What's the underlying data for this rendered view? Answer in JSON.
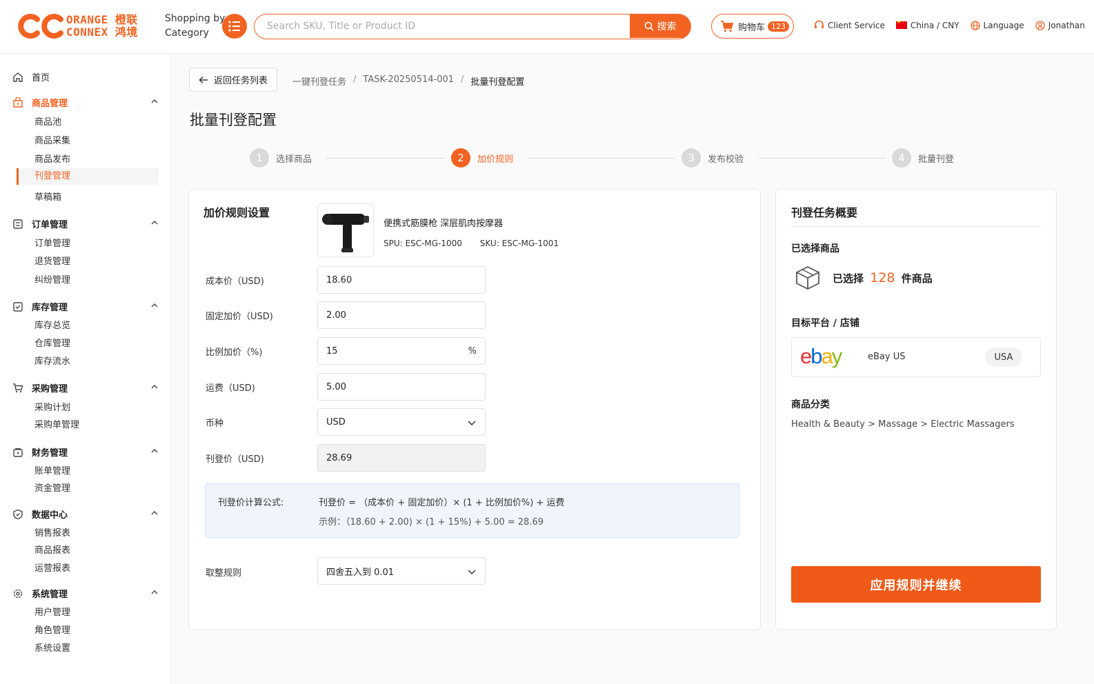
{
  "brand": {
    "line1": "ORANGE 橙联",
    "line2": "CONNEX 鸿境",
    "accent": "#f26322"
  },
  "header": {
    "shopping_by": "Shopping by",
    "category": "Category",
    "search_placeholder": "Search SKU, Title or Product ID",
    "search_button": "搜索",
    "cart_label": "购物车",
    "cart_count": "123",
    "client_service": "Client Service",
    "region": "China / CNY",
    "language": "Language",
    "user": "Jonathan"
  },
  "sidebar": {
    "home": "首页",
    "groups": [
      {
        "label": "商品管理",
        "icon": "shop-icon",
        "items": [
          "商品池",
          "商品采集",
          "商品发布",
          "刊登管理",
          "草稿箱"
        ]
      },
      {
        "label": "订单管理",
        "icon": "order-icon",
        "items": [
          "订单管理",
          "退货管理",
          "纠纷管理"
        ]
      },
      {
        "label": "库存管理",
        "icon": "inventory-icon",
        "items": [
          "库存总览",
          "仓库管理",
          "库存流水"
        ]
      },
      {
        "label": "采购管理",
        "icon": "cart-icon",
        "items": [
          "采购计划",
          "采购单管理"
        ]
      },
      {
        "label": "财务管理",
        "icon": "wallet-icon",
        "items": [
          "账单管理",
          "资金管理"
        ]
      },
      {
        "label": "数据中心",
        "icon": "shield-icon",
        "items": [
          "销售报表",
          "商品报表",
          "运营报表"
        ]
      },
      {
        "label": "系统管理",
        "icon": "gear-icon",
        "items": [
          "用户管理",
          "角色管理",
          "系统设置"
        ]
      }
    ]
  },
  "page": {
    "back_button": "返回任务列表",
    "breadcrumb": [
      "一键刊登任务",
      "TASK-20250514-001",
      "批量刊登配置"
    ],
    "title": "批量刊登配置",
    "steps": [
      {
        "num": "1",
        "label": "选择商品"
      },
      {
        "num": "2",
        "label": "加价规则"
      },
      {
        "num": "3",
        "label": "发布校验"
      },
      {
        "num": "4",
        "label": "批量刊登"
      }
    ],
    "active_step": 2
  },
  "pricing": {
    "section_title": "加价规则设置",
    "product_name": "便携式筋膜枪 深层肌肉按摩器",
    "spu": "SPU:  ESC-MG-1000",
    "sku": "SKU:  ESC-MG-1001",
    "fields": [
      {
        "label": "成本价（USD)",
        "value": "18.60"
      },
      {
        "label": "固定加价（USD)",
        "value": "2.00"
      },
      {
        "label": "比例加价（%)",
        "value": "15",
        "suffix": "%"
      },
      {
        "label": "运费（USD)",
        "value": "5.00"
      },
      {
        "label": "币种",
        "value": "USD"
      },
      {
        "label": "刊登价（USD)",
        "value": "28.69"
      }
    ],
    "formula_label": "刊登价计算公式:",
    "formula": "刊登价 = （成本价 + 固定加价）× (1 + 比例加价%) + 运费",
    "example": "示例：（18.60 + 2.00) × (1 + 15%) + 5.00 = 28.69",
    "rounding_label": "取整规则",
    "rounding_value": "四舍五入到 0.01"
  },
  "summary": {
    "title": "刊登任务概要",
    "selected_heading": "已选择商品",
    "selected_prefix": "已选择",
    "selected_count": "128",
    "selected_suffix": "件商品",
    "target_heading": "目标平台 / 店铺",
    "store_name": "eBay US",
    "country": "USA",
    "category_heading": "商品分类",
    "category_path": "Health & Beauty > Massage > Electric Massagers",
    "apply_button": "应用规则并继续"
  }
}
